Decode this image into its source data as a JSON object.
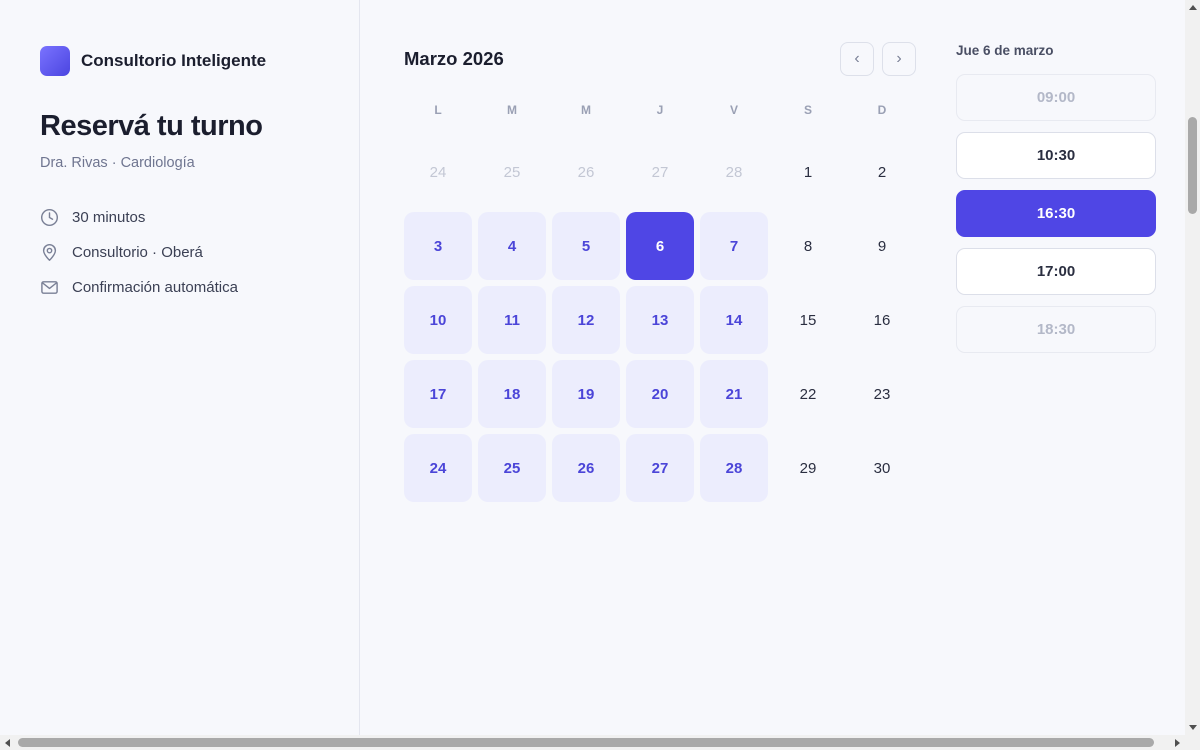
{
  "brand": {
    "name": "Consultorio Inteligente",
    "logo_icon": "gradient-square-logo"
  },
  "page": {
    "title": "Reservá tu turno",
    "subtitle": "Dra. Rivas · Cardiología"
  },
  "details": [
    {
      "icon": "clock-icon",
      "text": "30 minutos"
    },
    {
      "icon": "location-pin-icon",
      "text": "Consultorio · Oberá"
    },
    {
      "icon": "mail-icon",
      "text": "Confirmación automática"
    }
  ],
  "calendar": {
    "month_label": "Marzo 2026",
    "prev_icon": "chevron-left-icon",
    "next_icon": "chevron-right-icon",
    "prev_glyph": "‹",
    "next_glyph": "›",
    "weekdays": [
      "L",
      "M",
      "M",
      "J",
      "V",
      "S",
      "D"
    ],
    "weeks": [
      [
        {
          "label": "24",
          "state": "muted"
        },
        {
          "label": "25",
          "state": "muted"
        },
        {
          "label": "26",
          "state": "muted"
        },
        {
          "label": "27",
          "state": "muted"
        },
        {
          "label": "28",
          "state": "muted"
        },
        {
          "label": "1",
          "state": "plain"
        },
        {
          "label": "2",
          "state": "plain"
        }
      ],
      [
        {
          "label": "3",
          "state": "avail"
        },
        {
          "label": "4",
          "state": "avail"
        },
        {
          "label": "5",
          "state": "avail"
        },
        {
          "label": "6",
          "state": "selected"
        },
        {
          "label": "7",
          "state": "avail"
        },
        {
          "label": "8",
          "state": "plain"
        },
        {
          "label": "9",
          "state": "plain"
        }
      ],
      [
        {
          "label": "10",
          "state": "avail"
        },
        {
          "label": "11",
          "state": "avail"
        },
        {
          "label": "12",
          "state": "avail"
        },
        {
          "label": "13",
          "state": "avail"
        },
        {
          "label": "14",
          "state": "avail"
        },
        {
          "label": "15",
          "state": "plain"
        },
        {
          "label": "16",
          "state": "plain"
        }
      ],
      [
        {
          "label": "17",
          "state": "avail"
        },
        {
          "label": "18",
          "state": "avail"
        },
        {
          "label": "19",
          "state": "avail"
        },
        {
          "label": "20",
          "state": "avail"
        },
        {
          "label": "21",
          "state": "avail"
        },
        {
          "label": "22",
          "state": "plain"
        },
        {
          "label": "23",
          "state": "plain"
        }
      ],
      [
        {
          "label": "24",
          "state": "avail"
        },
        {
          "label": "25",
          "state": "avail"
        },
        {
          "label": "26",
          "state": "avail"
        },
        {
          "label": "27",
          "state": "avail"
        },
        {
          "label": "28",
          "state": "avail"
        },
        {
          "label": "29",
          "state": "plain"
        },
        {
          "label": "30",
          "state": "plain"
        }
      ]
    ]
  },
  "slots": {
    "date_label": "Jue 6 de marzo",
    "items": [
      {
        "time": "09:00",
        "state": "disabled"
      },
      {
        "time": "10:30",
        "state": "available"
      },
      {
        "time": "16:30",
        "state": "selected"
      },
      {
        "time": "17:00",
        "state": "available"
      },
      {
        "time": "18:30",
        "state": "disabled"
      }
    ]
  },
  "colors": {
    "accent": "#4f46e5",
    "accent_soft": "#ecedfd",
    "accent_text": "#4b45d8",
    "icon_stroke": "#7a8096"
  }
}
